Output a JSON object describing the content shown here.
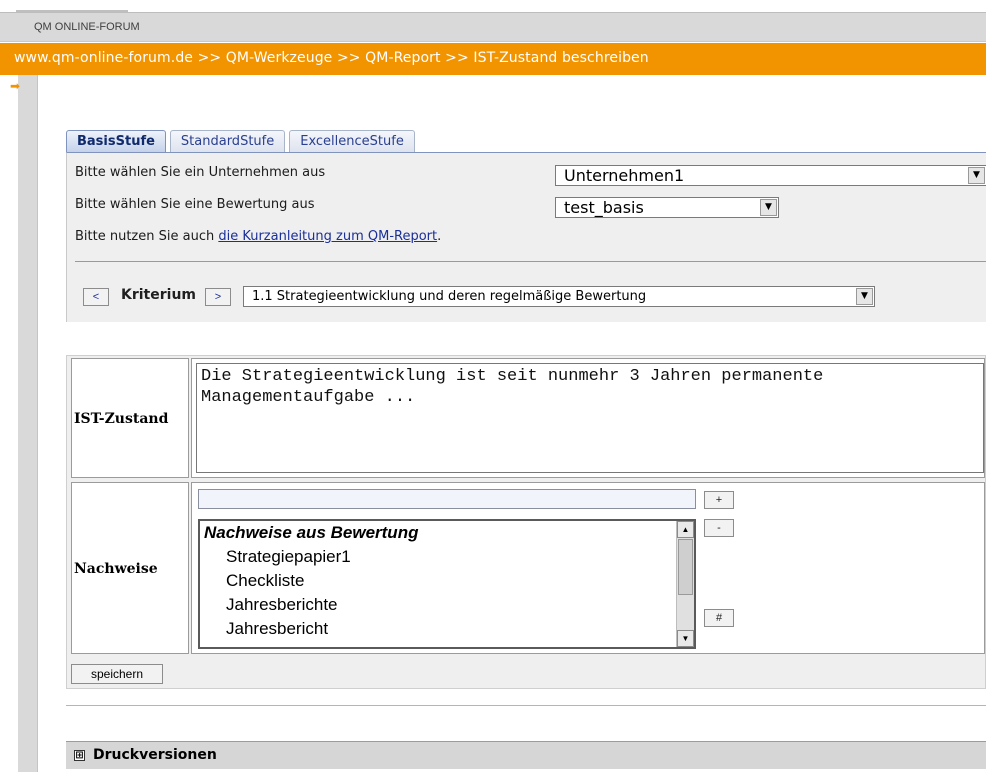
{
  "app": {
    "title": "QM ONLINE-FORUM",
    "breadcrumb": "www.qm-online-forum.de >> QM-Werkzeuge >> QM-Report >> IST-Zustand beschreiben"
  },
  "tabs": [
    {
      "label": "BasisStufe",
      "active": true
    },
    {
      "label": "StandardStufe",
      "active": false
    },
    {
      "label": "ExcellenceStufe",
      "active": false
    }
  ],
  "selection": {
    "company_label": "Bitte wählen Sie ein Unternehmen aus",
    "company_value": "Unternehmen1",
    "rating_label": "Bitte wählen Sie eine Bewertung aus",
    "rating_value": "test_basis",
    "hint_prefix": "Bitte nutzen Sie auch ",
    "hint_link": "die Kurzanleitung zum QM-Report",
    "hint_suffix": "."
  },
  "criterion": {
    "prev_label": "<",
    "label": "Kriterium",
    "next_label": ">",
    "value": "1.1 Strategieentwicklung und deren regelmäßige Bewertung"
  },
  "form": {
    "ist_label": "IST-Zustand",
    "ist_text": "Die Strategieentwicklung ist seit nunmehr 3 Jahren permanente\nManagementaufgabe ...",
    "nachweise_label": "Nachweise",
    "add_label": "+",
    "remove_label": "-",
    "hash_label": "#",
    "list_group": "Nachweise aus Bewertung",
    "list_items": [
      "Strategiepapier1",
      "Checkliste",
      "Jahresberichte",
      "Jahresbericht"
    ],
    "save_label": "speichern"
  },
  "druck": {
    "toggle": "⊞",
    "label": "Druckversionen"
  },
  "colors": {
    "accent_orange": "#f29400",
    "tab_blue": "#2a3f8f",
    "link_blue": "#1a2f99"
  }
}
